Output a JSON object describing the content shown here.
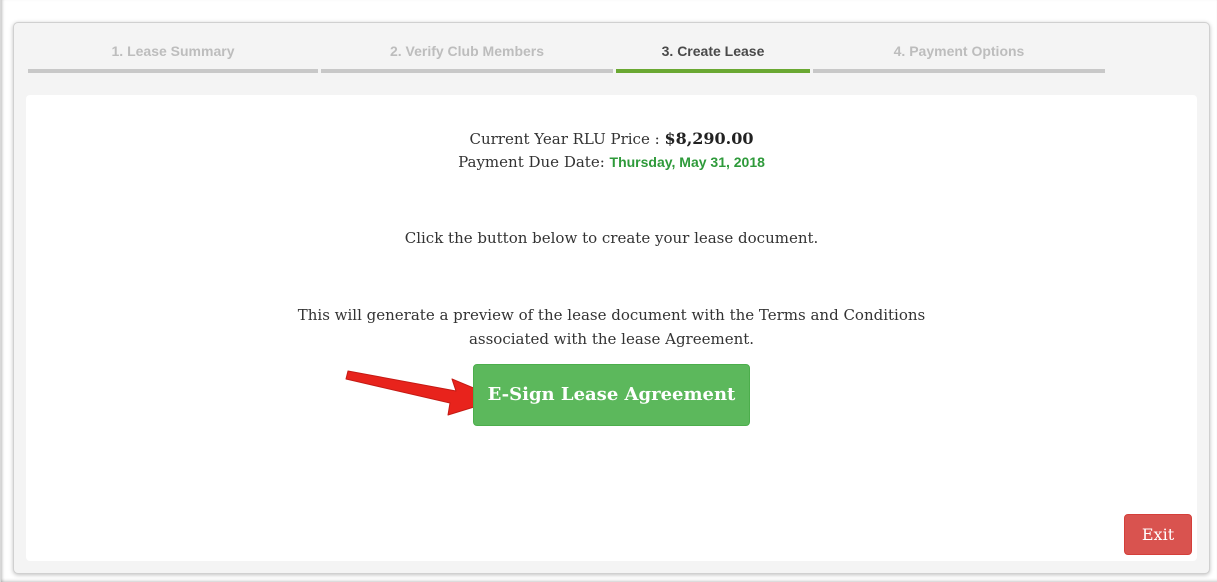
{
  "steps": [
    {
      "label": "1. Lease Summary",
      "active": false
    },
    {
      "label": "2. Verify Club Members",
      "active": false
    },
    {
      "label": "3. Create Lease",
      "active": true
    },
    {
      "label": "4. Payment Options",
      "active": false
    }
  ],
  "pricing": {
    "price_label": "Current Year RLU Price :",
    "price_value": "$8,290.00",
    "due_label": "Payment Due Date:",
    "due_value": "Thursday, May 31, 2018"
  },
  "instructions": {
    "line1": "Click the button below to create your lease document.",
    "preview_line1": "This will generate a preview of the lease document with the Terms and Conditions",
    "preview_line2": "associated with the lease Agreement."
  },
  "actions": {
    "esign_label": "E-Sign Lease Agreement",
    "exit_label": "Exit"
  },
  "colors": {
    "active_step_underline": "#6aa832",
    "due_date": "#2e9a3a",
    "esign_button": "#5cb85c",
    "exit_button": "#d9534f",
    "arrow": "#e8231c"
  },
  "icons": {
    "pointer": "red-arrow-icon"
  }
}
